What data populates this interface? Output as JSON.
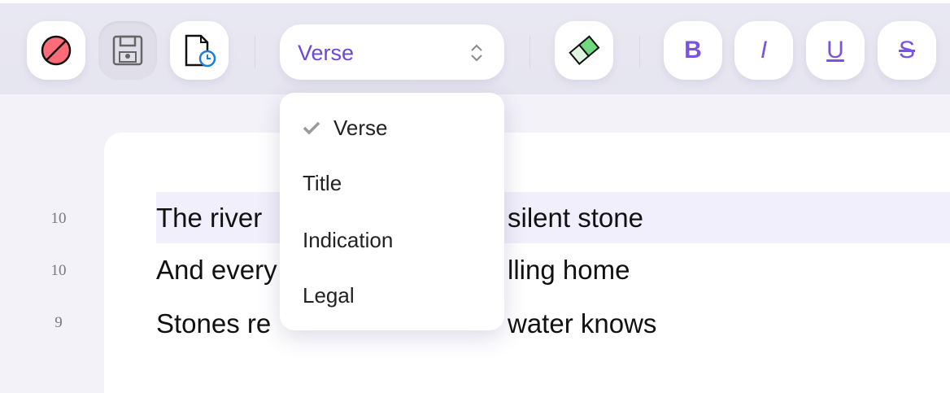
{
  "toolbar": {
    "buttons": [
      {
        "icon": "no-entry-icon"
      },
      {
        "icon": "save-icon",
        "pressed": true
      },
      {
        "icon": "document-history-icon"
      }
    ],
    "style_select": {
      "value": "Verse",
      "icon": "chevron-up-down-icon"
    },
    "eraser": {
      "icon": "eraser-icon"
    },
    "format": {
      "bold": "B",
      "italic": "I",
      "underline": "U",
      "strike": "S"
    }
  },
  "dropdown": {
    "options": [
      {
        "label": "Verse",
        "selected": true
      },
      {
        "label": "Title"
      },
      {
        "label": "Indication"
      },
      {
        "label": "Legal"
      }
    ]
  },
  "editor": {
    "lines": [
      {
        "number": "10",
        "pre": "The river",
        "post": "silent stone",
        "highlighted": true
      },
      {
        "number": "10",
        "pre": "And every",
        "post": "lling home"
      },
      {
        "number": "9",
        "pre": "Stones re",
        "post": "water knows"
      }
    ]
  },
  "colors": {
    "accent": "#6b47dc",
    "eraser": "#7ee08a",
    "stop": "#ff6b6b"
  }
}
